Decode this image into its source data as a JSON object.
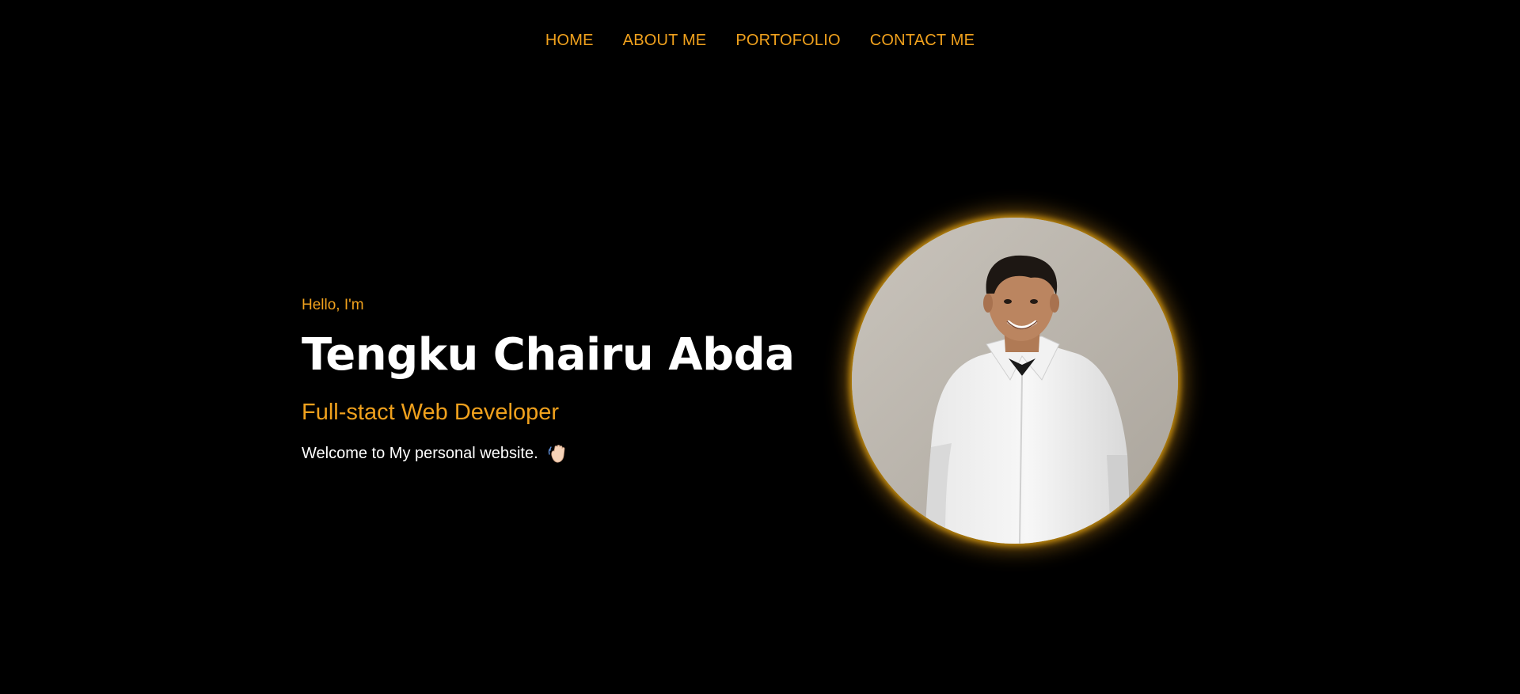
{
  "nav": {
    "items": [
      {
        "label": "HOME"
      },
      {
        "label": "ABOUT ME"
      },
      {
        "label": "PORTOFOLIO"
      },
      {
        "label": "CONTACT ME"
      }
    ]
  },
  "hero": {
    "greeting": "Hello, I'm",
    "name": "Tengku Chairu Abda",
    "role": "Full-stact Web Developer",
    "welcome": "Welcome to My personal website.",
    "welcome_icon": "waving-hand-icon"
  },
  "portrait": {
    "icon": "profile-photo"
  },
  "colors": {
    "background": "#000000",
    "accent": "#f0a11d",
    "text": "#ffffff"
  }
}
